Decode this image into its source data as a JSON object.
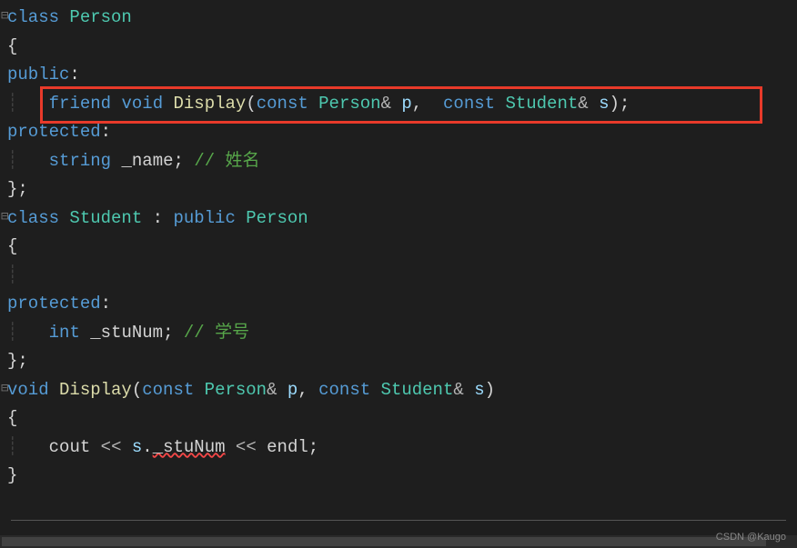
{
  "code": {
    "lines": [
      {
        "fold": "⊟",
        "tokens": [
          {
            "t": "class ",
            "c": "kw-blue"
          },
          {
            "t": "Person",
            "c": "type"
          }
        ]
      },
      {
        "fold": "",
        "guide": "",
        "tokens": [
          {
            "t": "{",
            "c": "punct"
          }
        ]
      },
      {
        "fold": "",
        "guide": "",
        "tokens": [
          {
            "t": "public",
            "c": "kw-blue"
          },
          {
            "t": ":",
            "c": "punct"
          }
        ]
      },
      {
        "fold": "",
        "guide": "|   ",
        "tokens": [
          {
            "t": "friend ",
            "c": "kw-blue"
          },
          {
            "t": "void ",
            "c": "kw-blue"
          },
          {
            "t": "Display",
            "c": "func-name"
          },
          {
            "t": "(",
            "c": "punct"
          },
          {
            "t": "const ",
            "c": "kw-blue"
          },
          {
            "t": "Person",
            "c": "type"
          },
          {
            "t": "& ",
            "c": "operator"
          },
          {
            "t": "p",
            "c": "param"
          },
          {
            "t": ",  ",
            "c": "punct"
          },
          {
            "t": "const ",
            "c": "kw-blue"
          },
          {
            "t": "Student",
            "c": "type"
          },
          {
            "t": "& ",
            "c": "operator"
          },
          {
            "t": "s",
            "c": "param"
          },
          {
            "t": ");",
            "c": "punct"
          }
        ]
      },
      {
        "fold": "",
        "guide": "",
        "tokens": [
          {
            "t": "protected",
            "c": "kw-blue"
          },
          {
            "t": ":",
            "c": "punct"
          }
        ]
      },
      {
        "fold": "",
        "guide": "|   ",
        "tokens": [
          {
            "t": "string ",
            "c": "string-kw"
          },
          {
            "t": "_name",
            "c": "field"
          },
          {
            "t": "; ",
            "c": "punct"
          },
          {
            "t": "// 姓名",
            "c": "comment"
          }
        ]
      },
      {
        "fold": "",
        "guide": "",
        "tokens": [
          {
            "t": "};",
            "c": "punct"
          }
        ]
      },
      {
        "fold": "⊟",
        "tokens": [
          {
            "t": "class ",
            "c": "kw-blue"
          },
          {
            "t": "Student ",
            "c": "type"
          },
          {
            "t": ": ",
            "c": "punct"
          },
          {
            "t": "public ",
            "c": "kw-blue"
          },
          {
            "t": "Person",
            "c": "type"
          }
        ]
      },
      {
        "fold": "",
        "guide": "",
        "tokens": [
          {
            "t": "{",
            "c": "punct"
          }
        ]
      },
      {
        "fold": "",
        "guide": "|",
        "tokens": []
      },
      {
        "fold": "",
        "guide": "",
        "tokens": [
          {
            "t": "protected",
            "c": "kw-blue"
          },
          {
            "t": ":",
            "c": "punct"
          }
        ]
      },
      {
        "fold": "",
        "guide": "|   ",
        "tokens": [
          {
            "t": "int ",
            "c": "kw-blue"
          },
          {
            "t": "_stuNum",
            "c": "field"
          },
          {
            "t": "; ",
            "c": "punct"
          },
          {
            "t": "// 学号",
            "c": "comment"
          }
        ]
      },
      {
        "fold": "",
        "guide": "",
        "tokens": [
          {
            "t": "};",
            "c": "punct"
          }
        ]
      },
      {
        "fold": "⊟",
        "tokens": [
          {
            "t": "void ",
            "c": "kw-blue"
          },
          {
            "t": "Display",
            "c": "func-name"
          },
          {
            "t": "(",
            "c": "punct"
          },
          {
            "t": "const ",
            "c": "kw-blue"
          },
          {
            "t": "Person",
            "c": "type"
          },
          {
            "t": "& ",
            "c": "operator"
          },
          {
            "t": "p",
            "c": "param"
          },
          {
            "t": ", ",
            "c": "punct"
          },
          {
            "t": "const ",
            "c": "kw-blue"
          },
          {
            "t": "Student",
            "c": "type"
          },
          {
            "t": "& ",
            "c": "operator"
          },
          {
            "t": "s",
            "c": "param"
          },
          {
            "t": ")",
            "c": "punct"
          }
        ]
      },
      {
        "fold": "",
        "guide": "",
        "tokens": [
          {
            "t": "{",
            "c": "punct"
          }
        ]
      },
      {
        "fold": "",
        "guide": "|   ",
        "tokens": [
          {
            "t": "cout ",
            "c": "field"
          },
          {
            "t": "<< ",
            "c": "operator"
          },
          {
            "t": "s",
            "c": "param"
          },
          {
            "t": ".",
            "c": "punct"
          },
          {
            "t": "_stuNum",
            "c": "field",
            "err": true
          },
          {
            "t": " << ",
            "c": "operator"
          },
          {
            "t": "endl",
            "c": "field"
          },
          {
            "t": ";",
            "c": "punct"
          }
        ]
      },
      {
        "fold": "",
        "guide": "",
        "tokens": [
          {
            "t": "}",
            "c": "punct"
          }
        ]
      }
    ]
  },
  "watermark": "CSDN @Kaugo"
}
